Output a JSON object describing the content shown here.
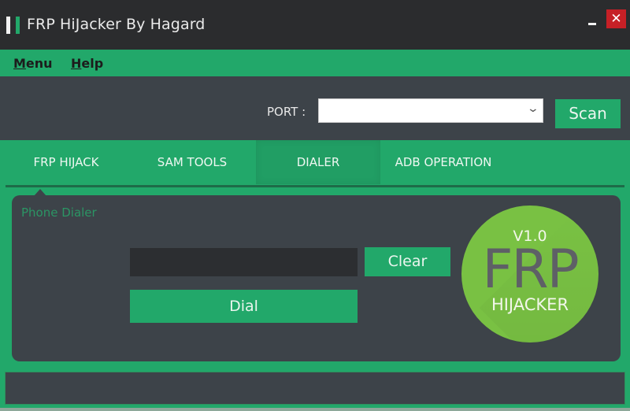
{
  "window": {
    "title": "FRP HiJacker By Hagard",
    "icons": {
      "app": "app-logo-icon",
      "minimize": "minimize-icon",
      "close": "close-icon"
    },
    "minimize_glyph": "",
    "close_glyph": "✕"
  },
  "menubar": {
    "items": [
      {
        "label": "Menu",
        "accel": "M",
        "rest": "enu"
      },
      {
        "label": "Help",
        "accel": "H",
        "rest": "elp"
      }
    ]
  },
  "port": {
    "label": "PORT :",
    "selected": "",
    "chevron": "⌄",
    "scan_label": "Scan"
  },
  "tabs": [
    {
      "label": "FRP HIJACK",
      "active": false
    },
    {
      "label": "SAM TOOLS",
      "active": false
    },
    {
      "label": "DIALER",
      "active": true
    },
    {
      "label": "ADB OPERATION",
      "active": false
    }
  ],
  "dialer": {
    "group_label": "Phone Dialer",
    "number_value": "",
    "clear_label": "Clear",
    "dial_label": "Dial"
  },
  "logo": {
    "version": "V1.0",
    "title": "FRP",
    "subtitle": "HIJACKER"
  },
  "status": {
    "text": ""
  },
  "colors": {
    "accent": "#22a86a",
    "panel": "#3d4349",
    "titlebar": "#2b2c2e",
    "close": "#c62026",
    "logo": "#79c143"
  }
}
